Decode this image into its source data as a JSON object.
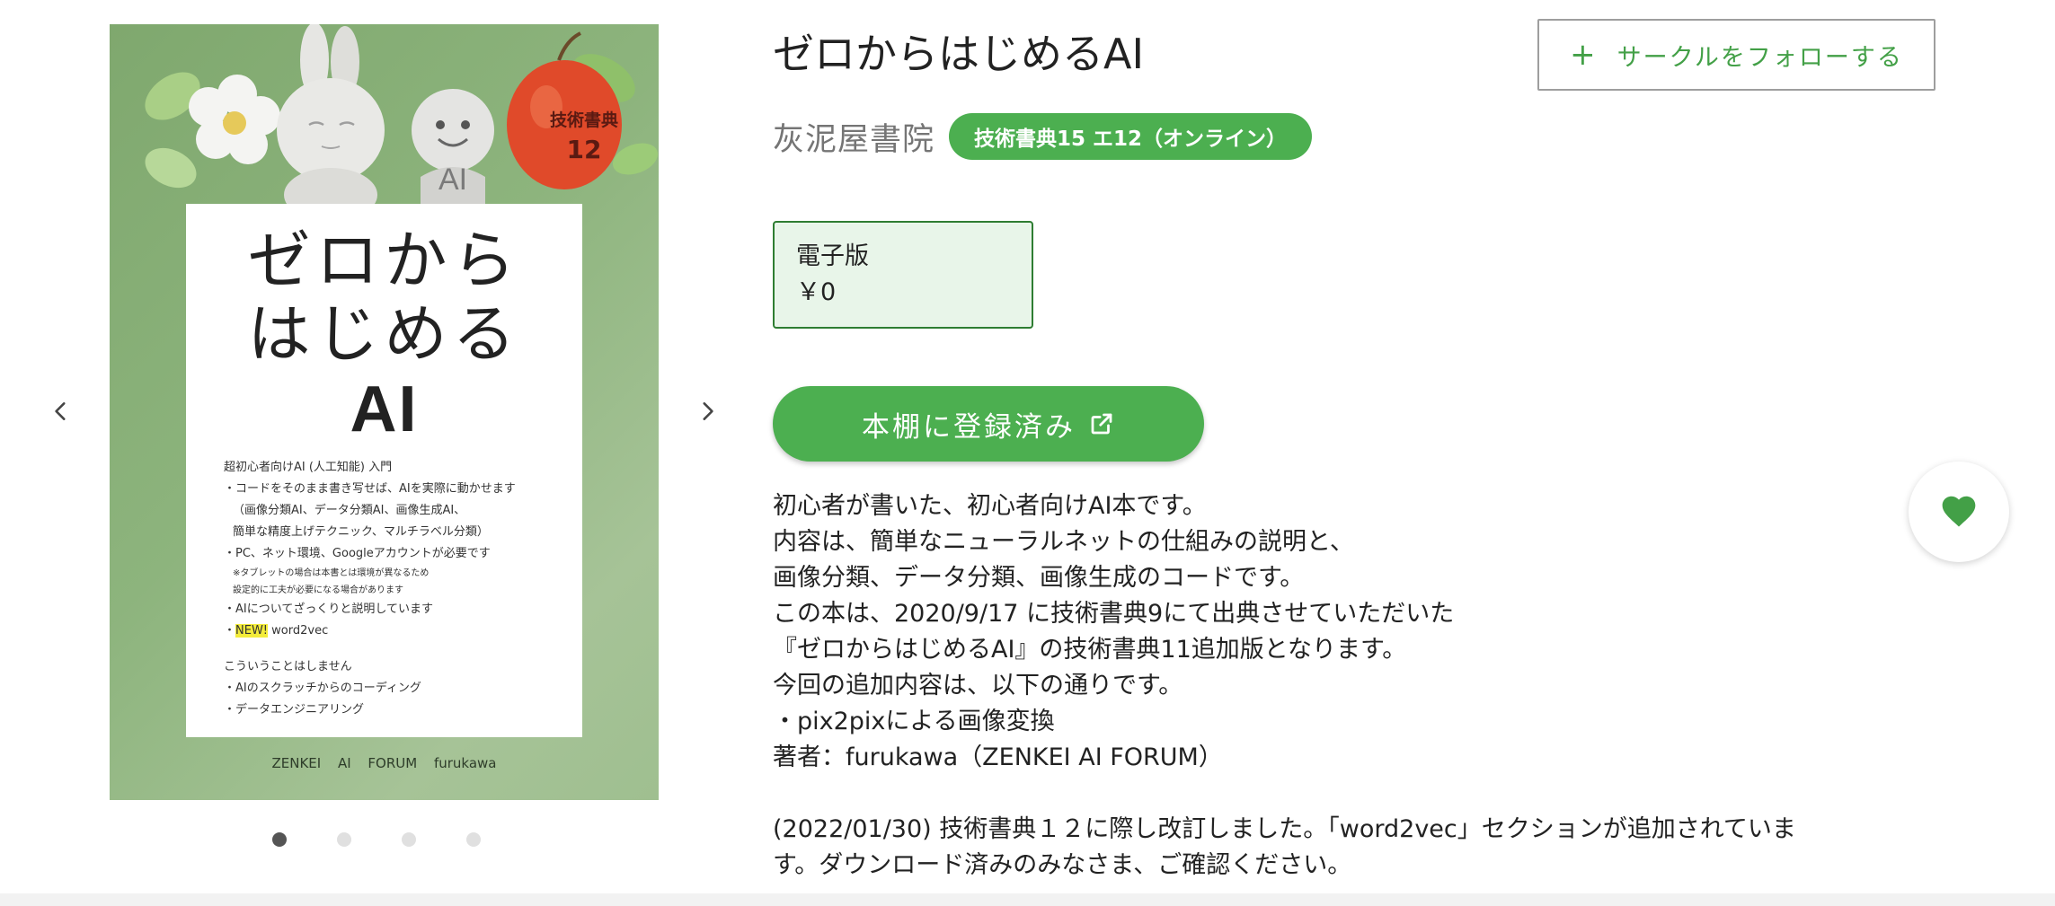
{
  "colors": {
    "accent": "#4caf50",
    "accent_dark": "#2e7d32",
    "edition_bg": "#e8f5e9",
    "cover_green": "#8db47d"
  },
  "carousel": {
    "prev_icon": "chevron-left-icon",
    "next_icon": "chevron-right-icon",
    "slide_count": 4,
    "active_slide": 1,
    "cover": {
      "badge_line1": "技術書典",
      "badge_line2": "12",
      "mascot_label": "AI",
      "title_line1": "ゼロから",
      "title_line2": "はじめる",
      "title_line3": "AI",
      "bullets": [
        {
          "text": "超初心者向けAI (人工知能) 入門",
          "style": "normal"
        },
        {
          "text": "・コードをそのまま書き写せば、AIを実際に動かせます",
          "style": "normal"
        },
        {
          "text": "（画像分類AI、データ分類AI、画像生成AI、",
          "style": "indent"
        },
        {
          "text": "簡単な精度上げテクニック、マルチラベル分類）",
          "style": "indent"
        },
        {
          "text": "・PC、ネット環境、Googleアカウントが必要です",
          "style": "normal"
        },
        {
          "text": "※タブレットの場合は本書とは環境が異なるため",
          "style": "small"
        },
        {
          "text": "設定的に工夫が必要になる場合があります",
          "style": "small"
        },
        {
          "text": "・AIについてざっくりと説明しています",
          "style": "normal"
        }
      ],
      "new_prefix": "・",
      "new_badge": "NEW!",
      "new_text": " word2vec",
      "not_covered_heading": "こういうことはしません",
      "not_covered": [
        "・AIのスクラッチからのコーディング",
        "・データエンジニアリング"
      ],
      "footer": "ZENKEI AI FORUM furukawa"
    }
  },
  "book": {
    "title": "ゼロからはじめるAI",
    "follow_label": "サークルをフォローする",
    "follow_icon": "plus-icon",
    "circle_name": "灰泥屋書院",
    "event_badge": "技術書典15 エ12（オンライン）",
    "edition": {
      "label": "電子版",
      "price": "￥0"
    },
    "shelf_button_label": "本棚に登録済み",
    "shelf_button_icon": "external-link-icon",
    "favorite_icon": "heart-icon",
    "description_lines": [
      "初心者が書いた、初心者向けAI本です。",
      "内容は、簡単なニューラルネットの仕組みの説明と、",
      "画像分類、データ分類、画像生成のコードです。",
      "この本は、2020/9/17 に技術書典9にて出典させていただいた",
      "『ゼロからはじめるAI』の技術書典11追加版となります。",
      "今回の追加内容は、以下の通りです。",
      "・pix2pixによる画像変換",
      "著者：furukawa（ZENKEI AI FORUM）"
    ],
    "description_lines_2": [
      "(2022/01/30) 技術書典１２に際し改訂しました。「word2vec」セクションが追加されていま",
      "す。ダウンロード済みのみなさま、ご確認ください。"
    ]
  }
}
